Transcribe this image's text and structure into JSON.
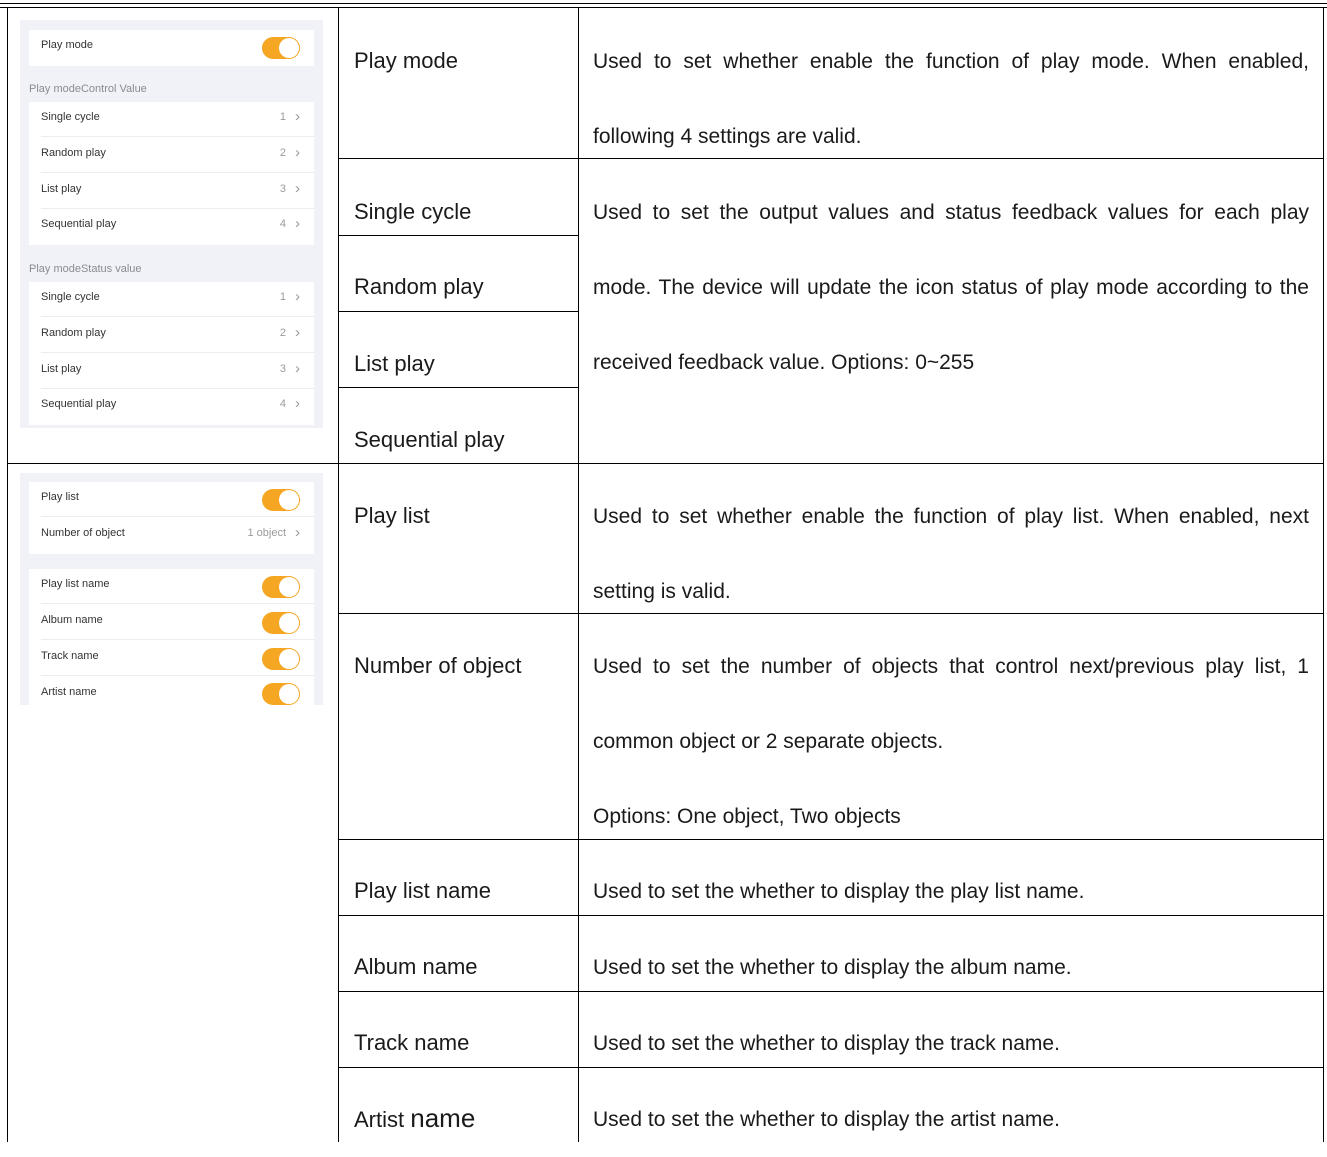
{
  "panel1": {
    "play_mode_label": "Play mode",
    "control_section": "Play modeControl Value",
    "control_rows": [
      {
        "label": "Single cycle",
        "value": "1"
      },
      {
        "label": "Random play",
        "value": "2"
      },
      {
        "label": "List play",
        "value": "3"
      },
      {
        "label": "Sequential play",
        "value": "4"
      }
    ],
    "status_section": "Play modeStatus value",
    "status_rows": [
      {
        "label": "Single cycle",
        "value": "1"
      },
      {
        "label": "Random play",
        "value": "2"
      },
      {
        "label": "List play",
        "value": "3"
      },
      {
        "label": "Sequential play",
        "value": "4"
      }
    ]
  },
  "panel2": {
    "play_list_label": "Play list",
    "number_label": "Number of object",
    "number_value": "1 object",
    "toggle_rows": [
      "Play list name",
      "Album name",
      "Track name",
      "Artist name"
    ]
  },
  "table": {
    "play_mode": {
      "name": "Play mode",
      "desc": "Used to set whether enable the function of play mode. When enabled, following 4 settings are valid."
    },
    "modes": {
      "names": [
        "Single cycle",
        "Random play",
        "List play",
        "Sequential play"
      ],
      "desc": "Used to set the output values and status feedback values for each play mode. The device will update the icon status of play mode according to the received feedback value. Options: 0~255"
    },
    "play_list": {
      "name": "Play list",
      "desc": "Used to set whether enable the function of play list. When enabled, next setting is valid."
    },
    "number_of_object": {
      "name": "Number of object",
      "desc": "Used to set the number of objects that control next/previous play list, 1 common object or 2 separate objects.",
      "options": "Options: One object, Two objects"
    },
    "play_list_name": {
      "name": "Play list name",
      "desc": "Used to set the whether to display the play list name."
    },
    "album_name": {
      "name": "Album name",
      "desc": "Used to set the whether to display the album name."
    },
    "track_name": {
      "name": "Track name",
      "desc": "Used to set the whether to display the track name."
    },
    "artist_name": {
      "name_a": "Artist ",
      "name_b": "name",
      "desc": "Used to set the whether to display the artist name."
    }
  },
  "colors": {
    "toggle_on": "#f5a623",
    "panel_bg": "#f1f1f8"
  }
}
